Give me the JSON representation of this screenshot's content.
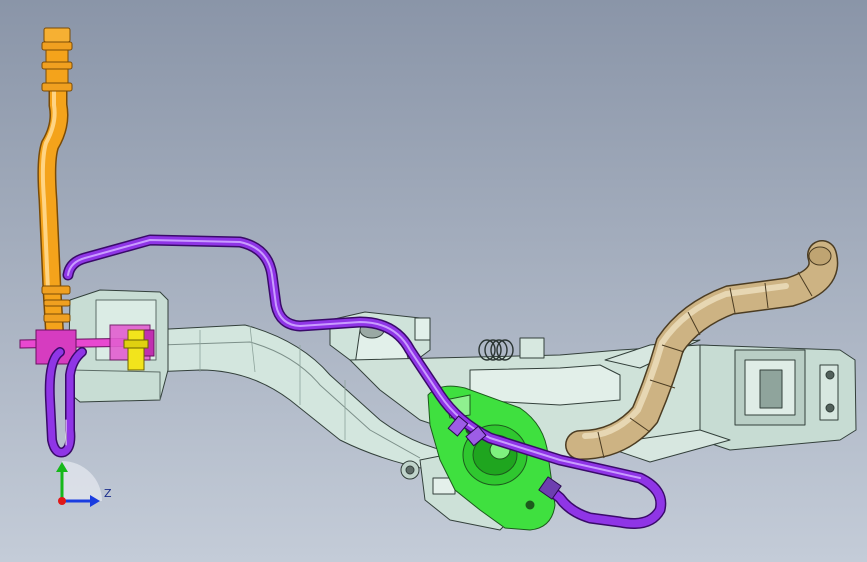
{
  "viewport": {
    "background_top": "#8a95a8",
    "background_bottom": "#c4ccd8"
  },
  "model": {
    "parts": [
      {
        "name": "filler-neck-pipe",
        "color": "#f2a11a"
      },
      {
        "name": "vent-line",
        "color": "#8a2be2"
      },
      {
        "name": "mounting-bracket",
        "color": "#d5e8e0"
      },
      {
        "name": "green-valve-housing",
        "color": "#35e035"
      },
      {
        "name": "tan-intake-hose",
        "color": "#c8ad7a"
      },
      {
        "name": "magenta-clip",
        "color": "#e040c8"
      },
      {
        "name": "yellow-fitting",
        "color": "#f0e020"
      }
    ]
  },
  "triad": {
    "y_axis_color": "#16b81a",
    "z_axis_color": "#1a3de0",
    "x_axis_color": "#e01818",
    "z_label": "Z"
  }
}
